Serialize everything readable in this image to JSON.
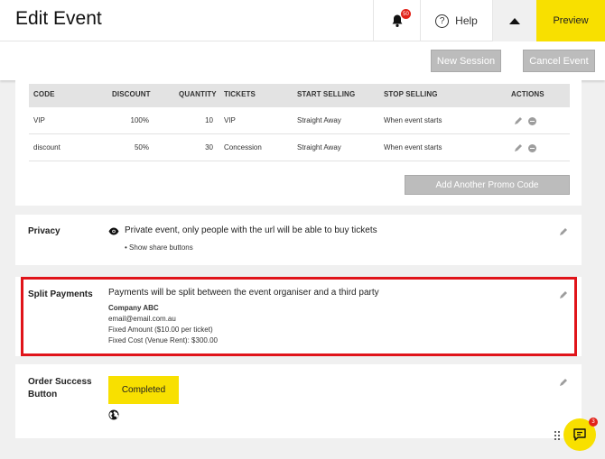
{
  "header": {
    "title": "Edit Event",
    "notification_count": "50",
    "help_label": "Help",
    "preview_label": "Preview"
  },
  "subbar": {
    "new_session_label": "New Session",
    "cancel_event_label": "Cancel Event"
  },
  "promo_codes": {
    "columns": [
      "CODE",
      "DISCOUNT",
      "QUANTITY",
      "TICKETS",
      "START SELLING",
      "STOP SELLING",
      "ACTIONS"
    ],
    "rows": [
      {
        "code": "VIP",
        "discount": "100%",
        "quantity": "10",
        "tickets": "VIP",
        "start": "Straight Away",
        "stop": "When event starts"
      },
      {
        "code": "discount",
        "discount": "50%",
        "quantity": "30",
        "tickets": "Concession",
        "start": "Straight Away",
        "stop": "When event starts"
      }
    ],
    "add_button_label": "Add Another Promo Code"
  },
  "privacy": {
    "label": "Privacy",
    "description": "Private event, only people with the url will be able to buy tickets",
    "option": "Show share buttons"
  },
  "split_payments": {
    "label": "Split Payments",
    "description": "Payments will be split between the event organiser and a third party",
    "company": "Company ABC",
    "email": "email@email.com.au",
    "fixed_amount": "Fixed Amount ($10.00 per ticket)",
    "fixed_cost": "Fixed Cost (Venue Rent): $300.00"
  },
  "order_success": {
    "label_line1": "Order Success",
    "label_line2": "Button",
    "button_label": "Completed"
  },
  "chat": {
    "badge_count": "3"
  },
  "colors": {
    "accent_yellow": "#f8e000",
    "highlight_red": "#e0141a",
    "button_gray": "#bcbcbc"
  },
  "icons": [
    "bell-icon",
    "help-icon",
    "caret-up-icon",
    "pencil-icon",
    "remove-icon",
    "eye-icon",
    "globe-icon",
    "chat-icon",
    "drag-handle-icon"
  ]
}
